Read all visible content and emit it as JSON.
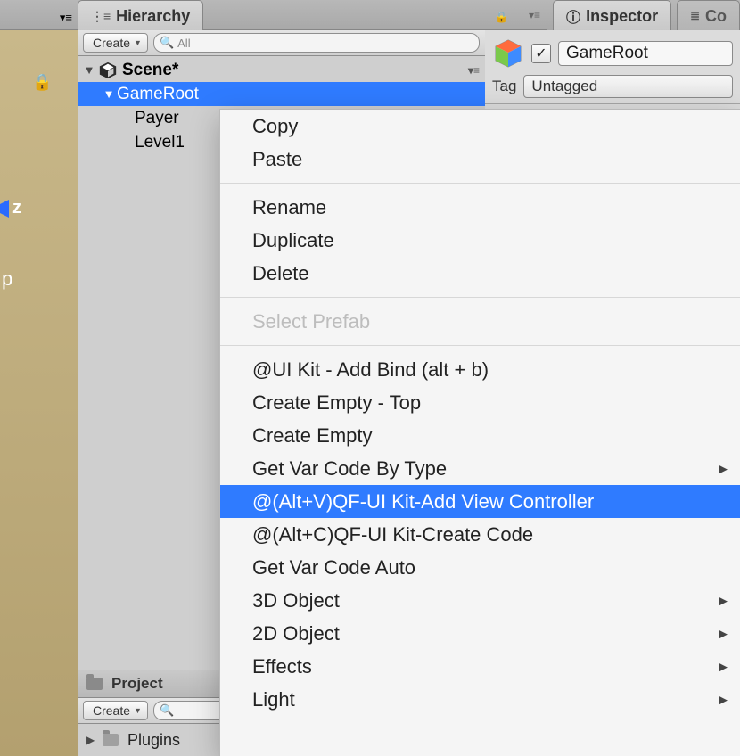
{
  "tabs": {
    "hierarchy": "Hierarchy",
    "inspector": "Inspector",
    "console_partial": "Co"
  },
  "hierarchy": {
    "create_label": "Create",
    "search_placeholder": "All",
    "scene_label": "Scene*",
    "items": [
      {
        "label": "GameRoot"
      },
      {
        "label": "Payer"
      },
      {
        "label": "Level1"
      }
    ]
  },
  "project": {
    "tab_label": "Project",
    "create_label": "Create",
    "items": [
      {
        "label": "Plugins"
      }
    ]
  },
  "inspector": {
    "name": "GameRoot",
    "tag_label": "Tag",
    "tag_value": "Untagged",
    "checked": "✓"
  },
  "gizmo": {
    "z": "z",
    "p": "p"
  },
  "context_menu": {
    "items": [
      {
        "label": "Copy"
      },
      {
        "label": "Paste"
      },
      "---",
      {
        "label": "Rename"
      },
      {
        "label": "Duplicate"
      },
      {
        "label": "Delete"
      },
      "---",
      {
        "label": "Select Prefab",
        "disabled": true
      },
      "---",
      {
        "label": "@UI Kit - Add Bind (alt + b)"
      },
      {
        "label": "Create Empty - Top"
      },
      {
        "label": "Create Empty"
      },
      {
        "label": "Get Var Code By Type",
        "sub": true
      },
      {
        "label": "@(Alt+V)QF-UI Kit-Add View Controller",
        "selected": true
      },
      {
        "label": "@(Alt+C)QF-UI Kit-Create Code"
      },
      {
        "label": "Get Var Code Auto"
      },
      {
        "label": "3D Object",
        "sub": true
      },
      {
        "label": "2D Object",
        "sub": true
      },
      {
        "label": "Effects",
        "sub": true
      },
      {
        "label": "Light",
        "sub": true
      }
    ]
  }
}
